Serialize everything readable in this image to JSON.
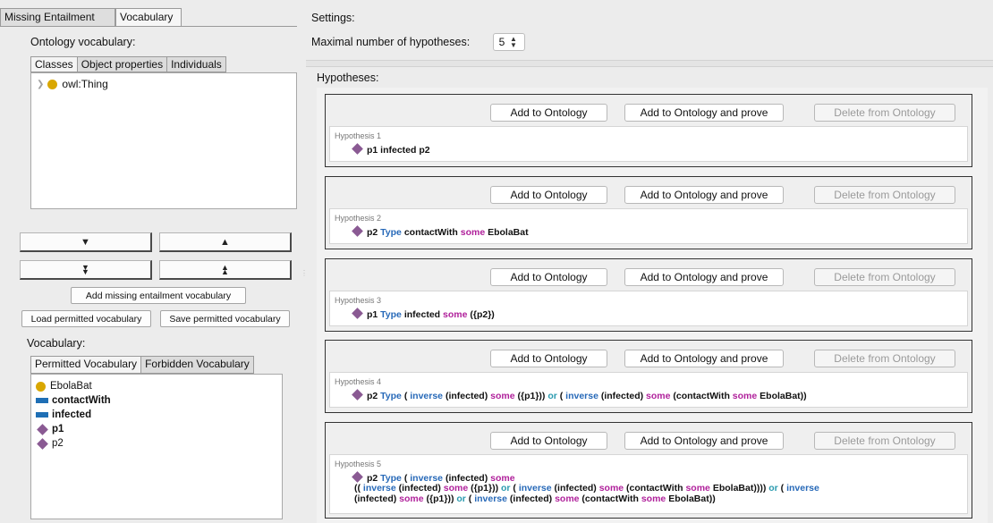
{
  "left": {
    "top_tabs": [
      "Missing Entailment",
      "Vocabulary"
    ],
    "ontology_vocab_label": "Ontology vocabulary:",
    "ontology_subtabs": [
      "Classes",
      "Object properties",
      "Individuals"
    ],
    "tree_root": "owl:Thing",
    "add_missing_label": "Add missing entailment vocabulary",
    "load_label": "Load permitted vocabulary",
    "save_label": "Save permitted vocabulary",
    "vocabulary_label": "Vocabulary:",
    "vocab_subtabs": [
      "Permitted Vocabulary",
      "Forbidden Vocabulary"
    ],
    "vocab_items": [
      {
        "type": "class",
        "label": "EbolaBat",
        "bold": false
      },
      {
        "type": "property",
        "label": "contactWith",
        "bold": true
      },
      {
        "type": "property",
        "label": "infected",
        "bold": true
      },
      {
        "type": "individual",
        "label": "p1",
        "bold": true
      },
      {
        "type": "individual",
        "label": "p2",
        "bold": false
      }
    ]
  },
  "right": {
    "settings_label": "Settings:",
    "max_hyp_label": "Maximal number of hypotheses:",
    "max_hyp_value": "5",
    "hypotheses_label": "Hypotheses:",
    "buttons": {
      "add": "Add to Ontology",
      "add_prove": "Add to Ontology and prove",
      "delete": "Delete from Ontology"
    },
    "hypotheses": [
      {
        "title": "Hypothesis 1"
      },
      {
        "title": "Hypothesis 2"
      },
      {
        "title": "Hypothesis 3"
      },
      {
        "title": "Hypothesis 4"
      },
      {
        "title": "Hypothesis 5"
      }
    ]
  },
  "colors": {
    "class_icon": "#d9a700",
    "property_icon": "#1f6fb5",
    "individual_icon": "#8a5a93",
    "keyword_blue": "#2769b8",
    "keyword_pink": "#b0219b",
    "keyword_teal": "#2a9aaf"
  }
}
